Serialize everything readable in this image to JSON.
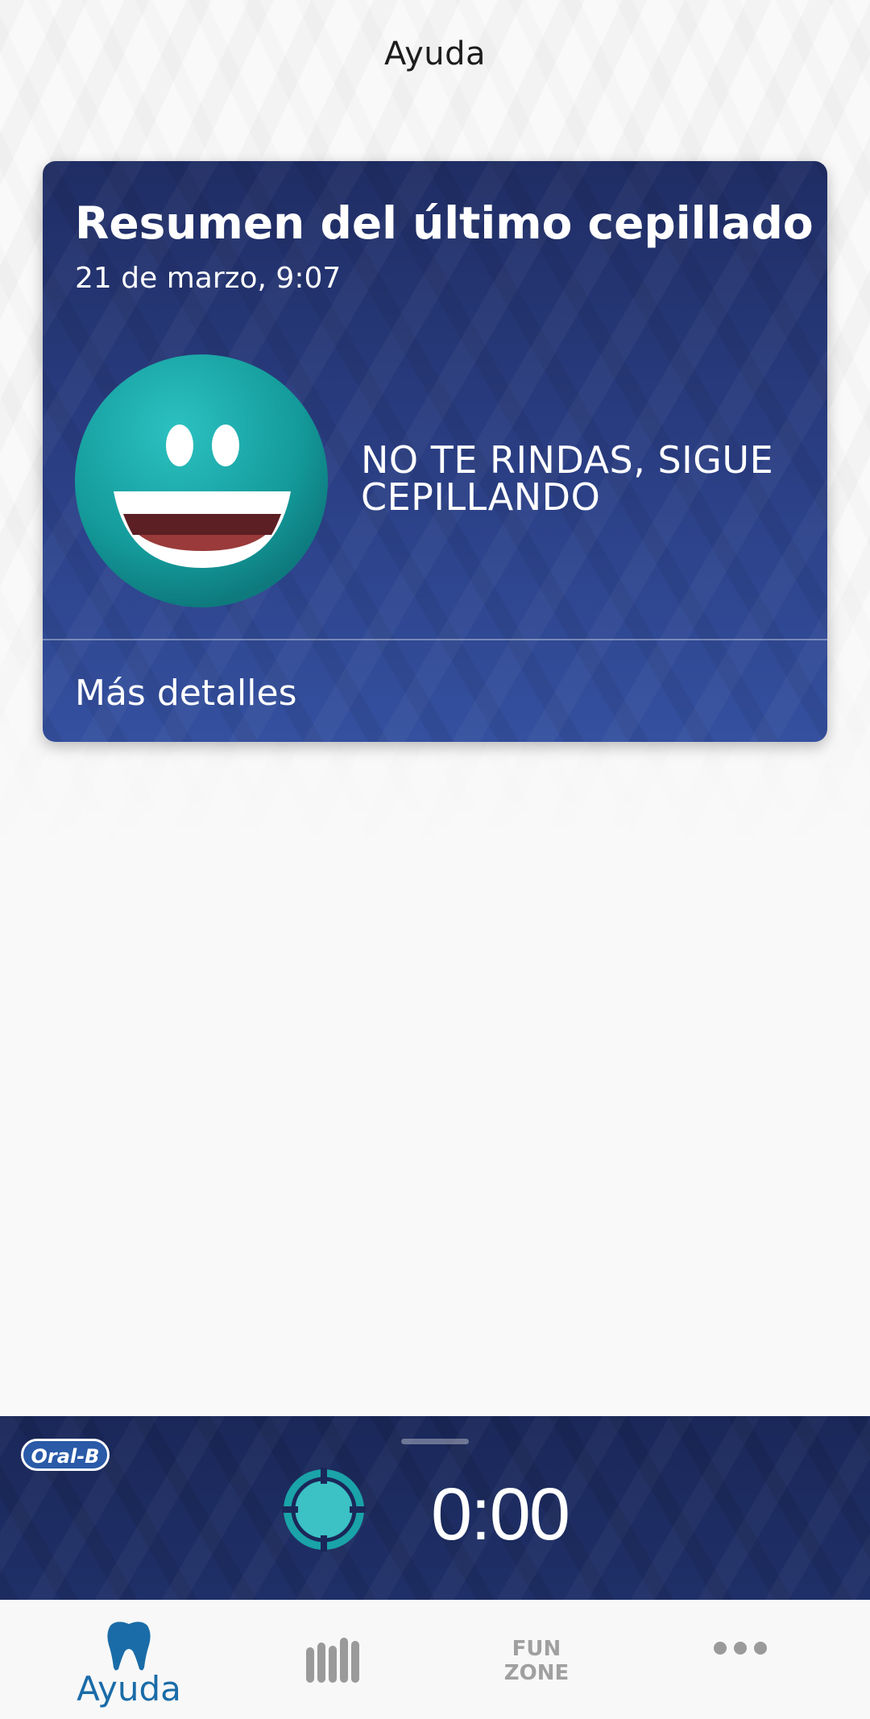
{
  "header": {
    "title": "Ayuda"
  },
  "summary_card": {
    "title": "Resumen del último cepillado",
    "date": "21 de marzo, 9:07",
    "message": "NO TE RINDAS, SIGUE CEPILLANDO",
    "details_link": "Más detalles"
  },
  "brush_bar": {
    "brand": "Oral-B",
    "timer": "0:00"
  },
  "bottom_nav": {
    "items": [
      {
        "label": "Ayuda",
        "icon": "tooth-icon",
        "active": true
      },
      {
        "label": "",
        "icon": "bar-chart-icon",
        "active": false
      },
      {
        "label": "FUN ZONE",
        "icon": "fun-zone-icon",
        "active": false
      },
      {
        "label": "",
        "icon": "more-dots-icon",
        "active": false
      }
    ]
  },
  "colors": {
    "accent": "#1a6ca8",
    "card_top": "#1f2d64",
    "card_bottom": "#34509f",
    "smiley": "#1fa3a3"
  }
}
